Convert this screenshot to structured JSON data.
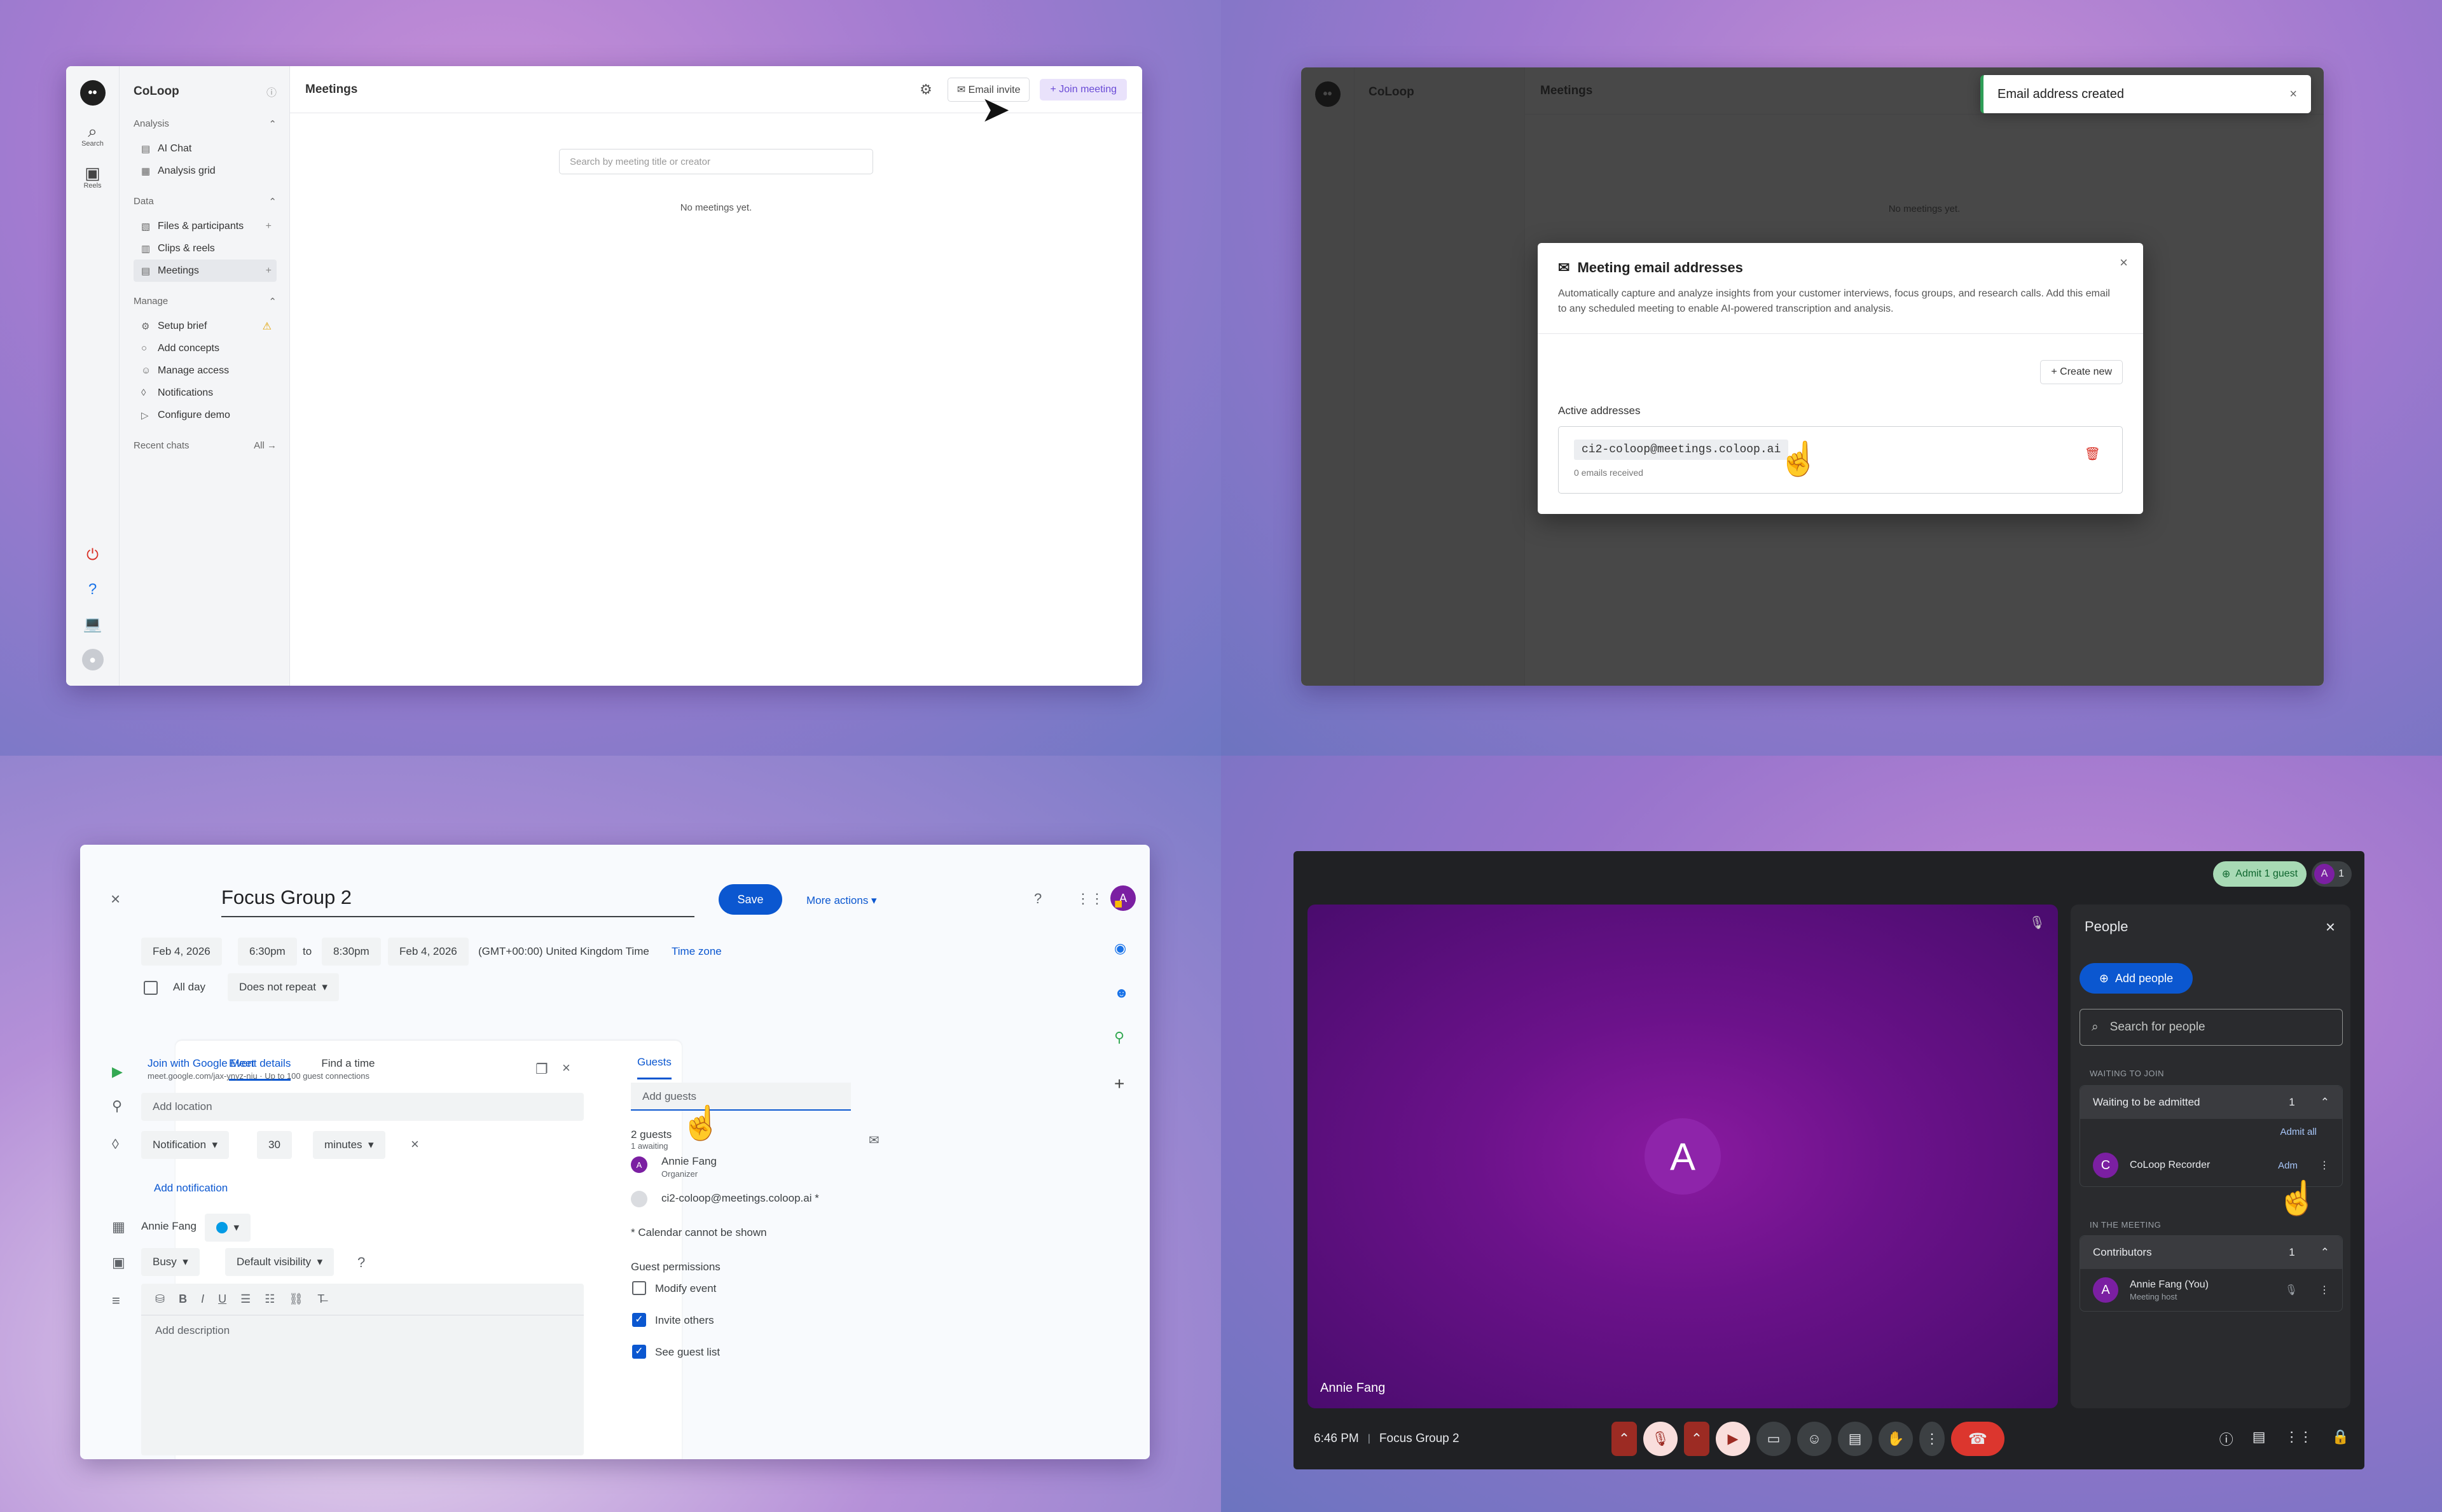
{
  "coloop": {
    "app_name": "CoLoop",
    "logo_glyph": "••",
    "rail": [
      {
        "icon": "search-icon",
        "glyph": "⌕",
        "label": "Search"
      },
      {
        "icon": "reels-icon",
        "glyph": "▣",
        "label": "Reels"
      }
    ],
    "sections": {
      "analysis": {
        "label": "Analysis",
        "items": [
          "AI Chat",
          "Analysis grid"
        ]
      },
      "data": {
        "label": "Data",
        "items": [
          "Files & participants",
          "Clips & reels",
          "Meetings"
        ]
      },
      "manage": {
        "label": "Manage",
        "items": [
          "Setup brief",
          "Add concepts",
          "Manage access",
          "Notifications",
          "Configure demo"
        ]
      }
    },
    "recent_label": "Recent chats",
    "all_label": "All",
    "page_title": "Meetings",
    "email_invite": "Email invite",
    "join_meeting": "Join meeting",
    "search_placeholder": "Search by meeting title or creator",
    "empty_text": "No meetings yet.",
    "accent": "#6a4bd6"
  },
  "modal": {
    "toast_text": "Email address created",
    "title": "Meeting email addresses",
    "description": "Automatically capture and analyze insights from your customer interviews, focus groups, and research calls. Add this email to any scheduled meeting to enable AI-powered transcription and analysis.",
    "create_new": "Create new",
    "active_label": "Active addresses",
    "address": "ci2-coloop@meetings.coloop.ai",
    "received": "0 emails received"
  },
  "calendar": {
    "title": "Focus Group 2",
    "save": "Save",
    "more_actions": "More actions",
    "start_date": "Feb 4, 2026",
    "start_time": "6:30pm",
    "to": "to",
    "end_time": "8:30pm",
    "end_date": "Feb 4, 2026",
    "timezone_text": "(GMT+00:00) United Kingdom Time",
    "timezone_link": "Time zone",
    "all_day": "All day",
    "repeat": "Does not repeat",
    "tab_details": "Event details",
    "tab_find": "Find a time",
    "meet_link": "Join with Google Meet",
    "meet_sub": "meet.google.com/jax-ynyz-niu · Up to 100 guest connections",
    "location_placeholder": "Add location",
    "notification": "Notification",
    "notify_value": "30",
    "notify_unit": "minutes",
    "add_notification": "Add notification",
    "owner": "Annie Fang",
    "busy": "Busy",
    "visibility": "Default visibility",
    "description_placeholder": "Add description",
    "guests_tab": "Guests",
    "add_guests": "Add guests",
    "guest_count": "2 guests",
    "guest_awaiting": "1 awaiting",
    "guests": [
      {
        "initial": "A",
        "name": "Annie Fang",
        "role": "Organizer"
      },
      {
        "initial": "",
        "name": "ci2-coloop@meetings.coloop.ai *",
        "role": ""
      }
    ],
    "calendar_note": "* Calendar cannot be shown",
    "permissions_label": "Guest permissions",
    "permissions": [
      {
        "label": "Modify event",
        "checked": false
      },
      {
        "label": "Invite others",
        "checked": true
      },
      {
        "label": "See guest list",
        "checked": true
      }
    ],
    "user_initial": "A"
  },
  "meet": {
    "admit_pill": "Admit 1 guest",
    "user_initial": "A",
    "participant_count": "1",
    "tile_name": "Annie Fang",
    "tile_initial": "A",
    "people_title": "People",
    "add_people": "Add people",
    "search_placeholder": "Search for people",
    "waiting_label": "WAITING TO JOIN",
    "waiting_group": "Waiting to be admitted",
    "waiting_count": "1",
    "admit_all": "Admit all",
    "waiting_person": {
      "initial": "C",
      "name": "CoLoop Recorder",
      "action": "Adm"
    },
    "in_meeting_label": "IN THE MEETING",
    "contributors_group": "Contributors",
    "contributors_count": "1",
    "host": {
      "initial": "A",
      "name": "Annie Fang (You)",
      "role": "Meeting host"
    },
    "time": "6:46 PM",
    "separator": "|",
    "meeting_name": "Focus Group 2"
  }
}
